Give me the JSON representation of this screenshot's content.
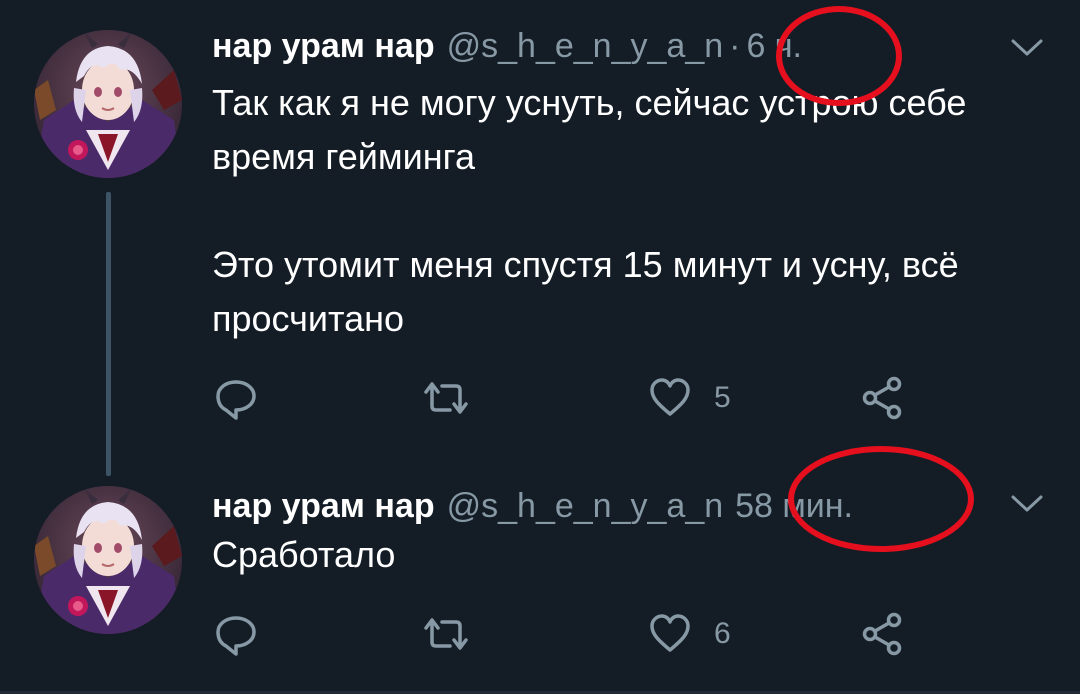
{
  "tweets": [
    {
      "display_name": "нар урам нар",
      "handle": "@s_h_e_n_y_a_n",
      "separator": "·",
      "time": "6 ч.",
      "paragraphs": [
        "Так как я не могу уснуть, сейчас устрою себе время гейминга",
        "Это утомит меня спустя 15 минут и усну, всё просчитано"
      ],
      "reply_count": "",
      "retweet_count": "",
      "like_count": "5"
    },
    {
      "display_name": "нар урам нар",
      "handle": "@s_h_e_n_y_a_n",
      "separator": "",
      "time": "58 мин.",
      "paragraphs": [
        "Сработало"
      ],
      "reply_count": "",
      "retweet_count": "",
      "like_count": "6"
    }
  ],
  "icons": {
    "reply": "reply-icon",
    "retweet": "retweet-icon",
    "like": "heart-icon",
    "share": "share-icon",
    "menu": "chevron-down-icon"
  },
  "colors": {
    "background": "#141d26",
    "text_primary": "#ffffff",
    "text_secondary": "#8899a6",
    "thread_line": "#3d5466",
    "annotation_circle": "#e50f1e"
  }
}
